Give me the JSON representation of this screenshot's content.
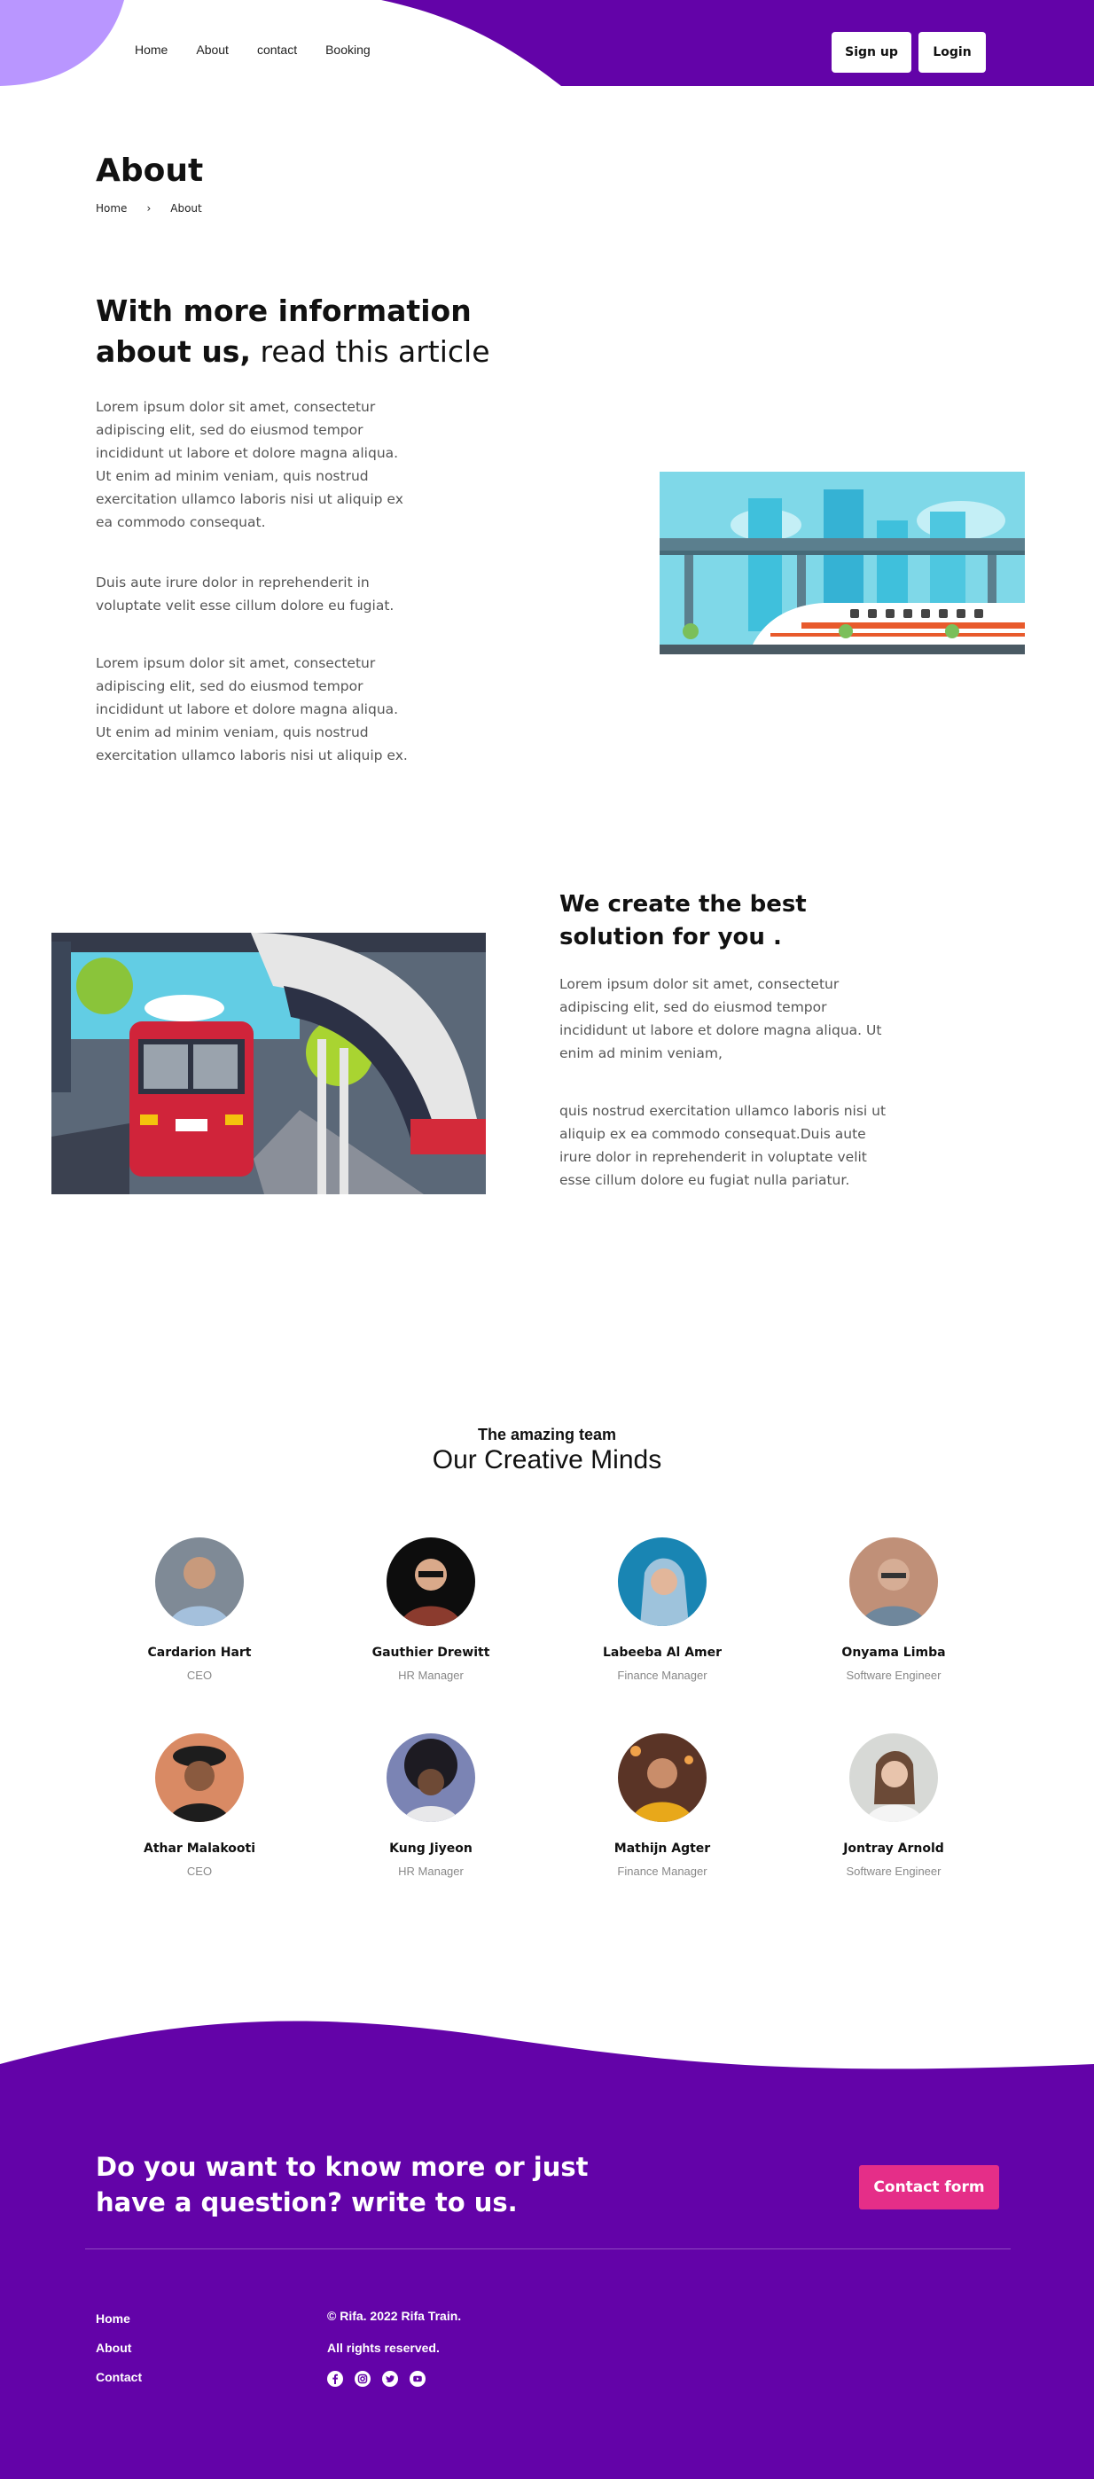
{
  "colors": {
    "brand": "#6303a8",
    "brand_light": "#b996ff",
    "accent": "#e52e88"
  },
  "nav": {
    "items": [
      "Home",
      "About",
      "contact",
      "Booking"
    ],
    "signup": "Sign up",
    "login": "Login"
  },
  "page": {
    "title": "About",
    "breadcrumb": [
      "Home",
      "About"
    ],
    "breadcrumb_sep": "›"
  },
  "about": {
    "heading_bold": "With more information about us,",
    "heading_light": " read this article",
    "p1": "Lorem ipsum dolor sit amet, consectetur adipiscing elit, sed do eiusmod tempor incididunt ut labore et dolore magna aliqua. Ut enim ad minim veniam, quis nostrud exercitation ullamco laboris nisi ut aliquip ex ea commodo consequat.",
    "p2": "Duis aute irure dolor in reprehenderit in voluptate velit esse cillum dolore eu fugiat.",
    "p3": "Lorem ipsum dolor sit amet, consectetur adipiscing elit, sed do eiusmod tempor incididunt ut labore et dolore magna aliqua. Ut enim ad minim veniam, quis nostrud exercitation ullamco laboris nisi ut aliquip ex."
  },
  "solution": {
    "heading_bold": "We create the best",
    "heading_light": "solution for you .",
    "p1": "Lorem ipsum dolor sit amet, consectetur adipiscing elit, sed do eiusmod tempor incididunt ut labore et dolore magna aliqua. Ut enim ad minim veniam,",
    "p2": "quis nostrud exercitation ullamco laboris nisi ut aliquip ex ea commodo consequat.Duis aute irure dolor in reprehenderit in voluptate velit esse cillum dolore eu fugiat nulla pariatur."
  },
  "team": {
    "kicker": "The amazing team",
    "title": "Our Creative Minds",
    "members": [
      {
        "name": "Cardarion Hart",
        "role": "CEO"
      },
      {
        "name": "Gauthier Drewitt",
        "role": "HR Manager"
      },
      {
        "name": "Labeeba Al Amer",
        "role": "Finance Manager"
      },
      {
        "name": "Onyama Limba",
        "role": "Software Engineer"
      },
      {
        "name": "Athar Malakooti",
        "role": "CEO"
      },
      {
        "name": "Kung Jiyeon",
        "role": "HR Manager"
      },
      {
        "name": "Mathijn Agter",
        "role": "Finance Manager"
      },
      {
        "name": "Jontray Arnold",
        "role": "Software Engineer"
      }
    ]
  },
  "footer": {
    "cta": "Do you want to know more or just have a question? write to us.",
    "cta_button": "Contact form",
    "links": [
      "Home",
      "About",
      "Contact"
    ],
    "copyright": "© Rifa. 2022 Rifa Train.",
    "rights": "All rights reserved.",
    "socials": [
      "facebook-icon",
      "instagram-icon",
      "twitter-icon",
      "youtube-icon"
    ]
  }
}
